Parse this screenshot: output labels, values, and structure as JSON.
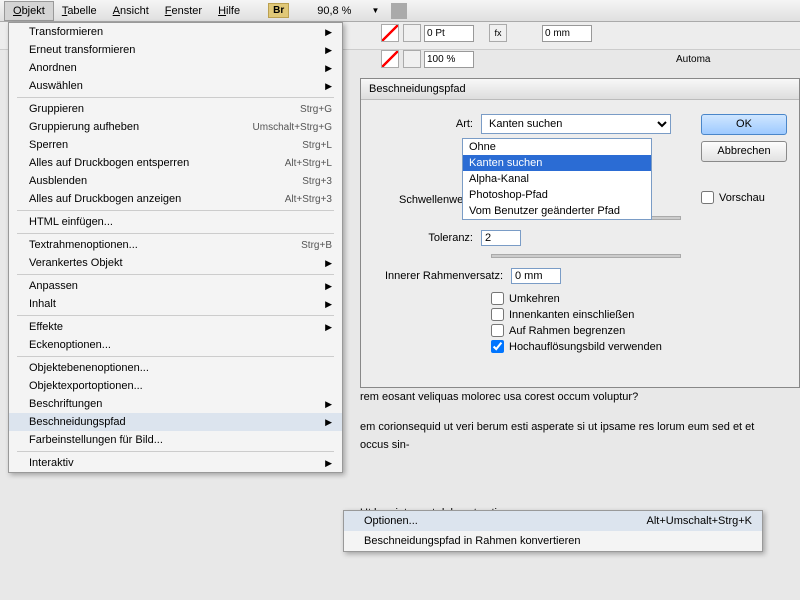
{
  "menubar": {
    "items": [
      "Objekt",
      "Tabelle",
      "Ansicht",
      "Fenster",
      "Hilfe"
    ],
    "br": "Br",
    "zoom": "90,8 %"
  },
  "toolbar": {
    "stroke": "0 Pt",
    "scale": "100 %",
    "dim": "0 mm",
    "auto": "Automa"
  },
  "menu": {
    "items": [
      {
        "l": "Transformieren",
        "a": true
      },
      {
        "l": "Erneut transformieren",
        "a": true
      },
      {
        "l": "Anordnen",
        "a": true
      },
      {
        "l": "Auswählen",
        "a": true
      },
      {
        "hr": true
      },
      {
        "l": "Gruppieren",
        "s": "Strg+G",
        "d": true
      },
      {
        "l": "Gruppierung aufheben",
        "s": "Umschalt+Strg+G",
        "d": true
      },
      {
        "l": "Sperren",
        "s": "Strg+L",
        "d": true
      },
      {
        "l": "Alles auf Druckbogen entsperren",
        "s": "Alt+Strg+L",
        "d": true
      },
      {
        "l": "Ausblenden",
        "s": "Strg+3"
      },
      {
        "l": "Alles auf Druckbogen anzeigen",
        "s": "Alt+Strg+3",
        "d": true
      },
      {
        "hr": true
      },
      {
        "l": "HTML einfügen..."
      },
      {
        "hr": true
      },
      {
        "l": "Textrahmenoptionen...",
        "s": "Strg+B",
        "d": true
      },
      {
        "l": "Verankertes Objekt",
        "a": true
      },
      {
        "hr": true
      },
      {
        "l": "Anpassen",
        "a": true
      },
      {
        "l": "Inhalt",
        "a": true
      },
      {
        "hr": true
      },
      {
        "l": "Effekte",
        "a": true
      },
      {
        "l": "Eckenoptionen...",
        "d": true
      },
      {
        "hr": true
      },
      {
        "l": "Objektebenenoptionen..."
      },
      {
        "l": "Objektexportoptionen..."
      },
      {
        "l": "Beschriftungen",
        "a": true
      },
      {
        "l": "Beschneidungspfad",
        "a": true,
        "hover": true
      },
      {
        "l": "Farbeinstellungen für Bild..."
      },
      {
        "hr": true
      },
      {
        "l": "Interaktiv",
        "a": true
      }
    ]
  },
  "submenu": {
    "opt": {
      "l": "Optionen...",
      "s": "Alt+Umschalt+Strg+K"
    },
    "conv": "Beschneidungspfad in Rahmen konvertieren"
  },
  "dialog": {
    "title": "Beschneidungspfad",
    "art": "Art:",
    "art_val": "Kanten suchen",
    "options": [
      "Ohne",
      "Kanten suchen",
      "Alpha-Kanal",
      "Photoshop-Pfad",
      "Vom Benutzer geänderter Pfad"
    ],
    "schwellen": "Schwellenwert:",
    "toleranz": "Toleranz:",
    "toleranz_val": "2",
    "innerer": "Innerer Rahmenversatz:",
    "innerer_val": "0 mm",
    "umkehren": "Umkehren",
    "innen": "Innenkanten einschließen",
    "rahmen": "Auf Rahmen begrenzen",
    "hoch": "Hochauflösungsbild verwenden",
    "ok": "OK",
    "cancel": "Abbrechen",
    "preview": "Vorschau"
  },
  "doc": {
    "p1": "rem eosant veliquas molorec usa corest occum voluptur?",
    "p2": "em corionsequid ut veri berum esti asperate si ut ipsame res lorum eum sed et et occus sin-",
    "p3": "Ut harciatur aut doles et estia"
  }
}
